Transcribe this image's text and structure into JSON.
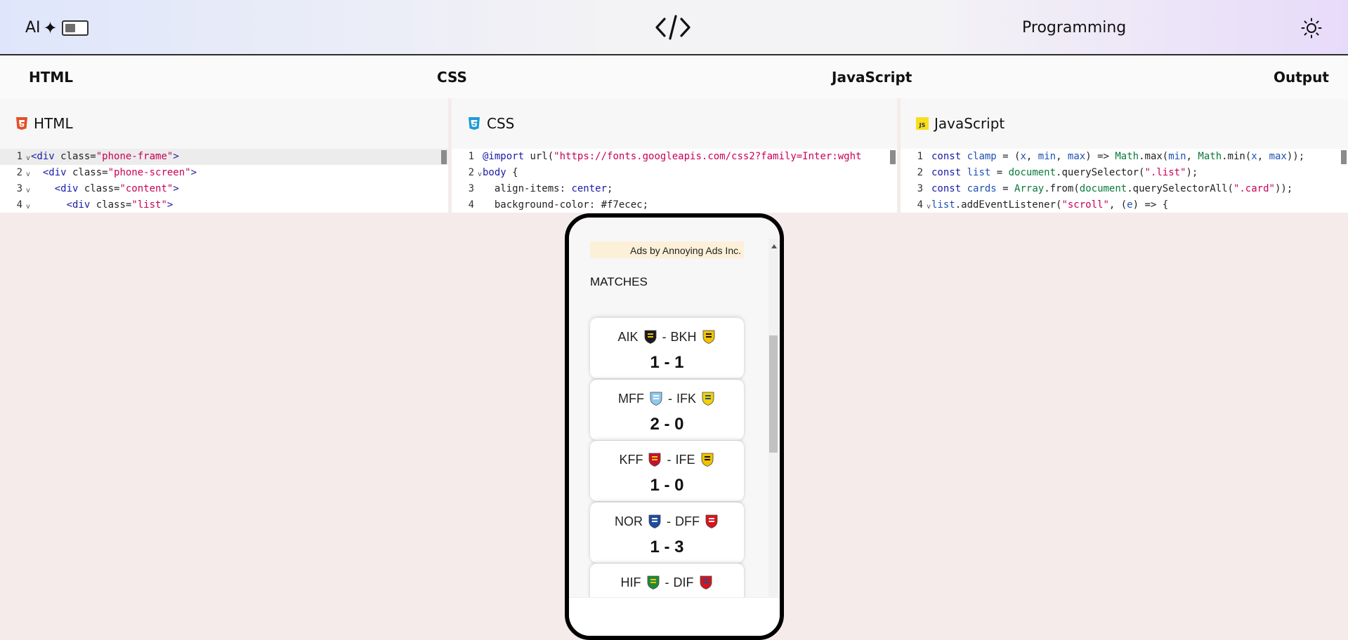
{
  "header": {
    "ai_label": "AI",
    "ai_star": "✦",
    "logo_icon": "code-brackets-icon",
    "topic": "Programming",
    "theme_icon": "sun-icon",
    "ai_toggle_on": false
  },
  "tabs": [
    {
      "label": "HTML"
    },
    {
      "label": "CSS"
    },
    {
      "label": "JavaScript"
    },
    {
      "label": "Output"
    }
  ],
  "editors": {
    "html": {
      "title": "HTML",
      "icon": "html5-icon",
      "lines": [
        {
          "n": "1",
          "text": "<div class=\"phone-frame\">"
        },
        {
          "n": "2",
          "text": "  <div class=\"phone-screen\">"
        },
        {
          "n": "3",
          "text": "    <div class=\"content\">"
        },
        {
          "n": "4",
          "text": "      <div class=\"list\">"
        }
      ]
    },
    "css": {
      "title": "CSS",
      "icon": "css3-icon",
      "lines": [
        {
          "n": "1",
          "text": "@import url(\"https://fonts.googleapis.com/css2?family=Inter:wght"
        },
        {
          "n": "2",
          "text": "body {"
        },
        {
          "n": "3",
          "text": "  align-items: center;"
        },
        {
          "n": "4",
          "text": "  background-color: #f7ecec;"
        }
      ]
    },
    "js": {
      "title": "JavaScript",
      "icon": "js-icon",
      "lines": [
        {
          "n": "1",
          "text": "const clamp = (x, min, max) => Math.max(min, Math.min(x, max));"
        },
        {
          "n": "2",
          "text": "const list = document.querySelector(\".list\");"
        },
        {
          "n": "3",
          "text": "const cards = Array.from(document.querySelectorAll(\".card\"));"
        },
        {
          "n": "4",
          "text": "list.addEventListener(\"scroll\", (e) => {"
        }
      ]
    }
  },
  "output": {
    "ad_text": "Ads by Annoying Ads Inc.",
    "matches_title": "MATCHES",
    "matches": [
      {
        "home": "AIK",
        "home_crest": "aik-crest-icon",
        "away": "BKH",
        "away_crest": "bkh-crest-icon",
        "score": "1 - 1"
      },
      {
        "home": "MFF",
        "home_crest": "mff-crest-icon",
        "away": "IFK",
        "away_crest": "ifk-crest-icon",
        "score": "2 - 0"
      },
      {
        "home": "KFF",
        "home_crest": "kff-crest-icon",
        "away": "IFE",
        "away_crest": "ife-crest-icon",
        "score": "1 - 0"
      },
      {
        "home": "NOR",
        "home_crest": "nor-crest-icon",
        "away": "DFF",
        "away_crest": "dff-crest-icon",
        "score": "1 - 3"
      },
      {
        "home": "HIF",
        "home_crest": "hif-crest-icon",
        "away": "DIF",
        "away_crest": "dif-crest-icon",
        "score": ""
      }
    ],
    "separator": "-"
  },
  "colors": {
    "keyword": "#1a1aa6",
    "string": "#c80057",
    "builtin": "#0a7a3a",
    "page_bg": "#f5ebeb",
    "ad_bg": "#fdf0d9"
  }
}
